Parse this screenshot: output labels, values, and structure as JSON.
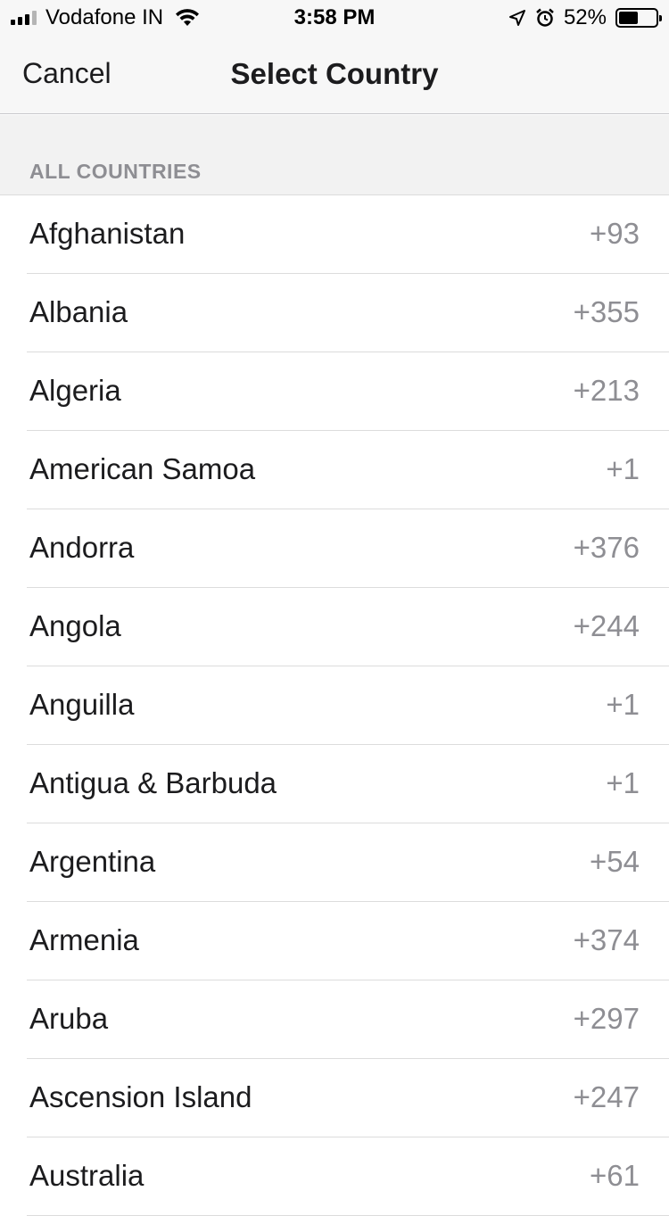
{
  "status_bar": {
    "carrier": "Vodafone IN",
    "time": "3:58 PM",
    "battery_percent": "52%",
    "battery_level": 0.52,
    "signal_bars": 3,
    "icons": [
      "signal-icon",
      "wifi-icon",
      "location-icon",
      "alarm-icon",
      "battery-icon"
    ]
  },
  "nav": {
    "cancel_label": "Cancel",
    "title": "Select Country"
  },
  "section": {
    "title": "ALL COUNTRIES"
  },
  "countries": [
    {
      "name": "Afghanistan",
      "code": "+93"
    },
    {
      "name": "Albania",
      "code": "+355"
    },
    {
      "name": "Algeria",
      "code": "+213"
    },
    {
      "name": "American Samoa",
      "code": "+1"
    },
    {
      "name": "Andorra",
      "code": "+376"
    },
    {
      "name": "Angola",
      "code": "+244"
    },
    {
      "name": "Anguilla",
      "code": "+1"
    },
    {
      "name": "Antigua & Barbuda",
      "code": "+1"
    },
    {
      "name": "Argentina",
      "code": "+54"
    },
    {
      "name": "Armenia",
      "code": "+374"
    },
    {
      "name": "Aruba",
      "code": "+297"
    },
    {
      "name": "Ascension Island",
      "code": "+247"
    },
    {
      "name": "Australia",
      "code": "+61"
    }
  ],
  "colors": {
    "text_primary": "#1c1c1e",
    "text_secondary": "#8e8e93",
    "bar_background": "#f7f7f7",
    "separator": "#dcdcdc"
  }
}
